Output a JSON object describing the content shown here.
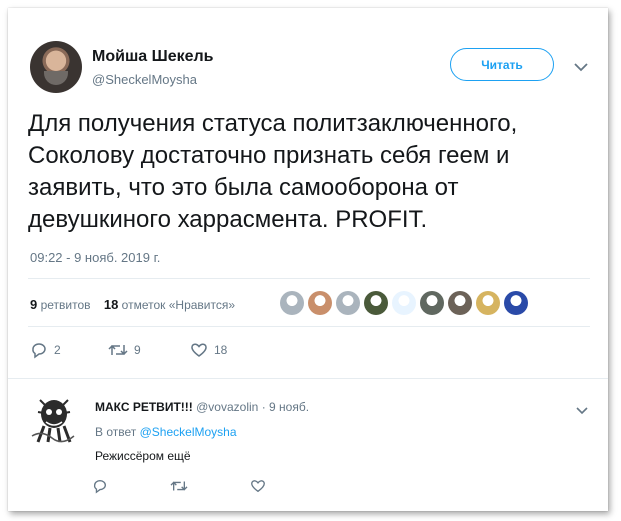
{
  "tweet": {
    "author_name": "Мойша Шекель",
    "author_handle": "@SheckelMoysha",
    "follow_label": "Читать",
    "text": "Для получения статуса политзаключенного,\nСоколову достаточно признать себя геем и\nзаявить, что это была самооборона от\nдевушкиного харрасмента. PROFIT.",
    "timestamp": "09:22 - 9 нояб. 2019 г.",
    "retweets_count": "9",
    "retweets_label": "ретвитов",
    "likes_count": "18",
    "likes_label": "отметок «Нравится»",
    "actions": {
      "reply_count": "2",
      "retweet_count": "9",
      "like_count": "18"
    },
    "liker_avatar_colors": [
      "#aab4bd",
      "#c98f6b",
      "#aab4bd",
      "#4a5a3a",
      "#e8f4ff",
      "#606860",
      "#6c6258",
      "#d6b460",
      "#2a4aa8"
    ]
  },
  "reply": {
    "author_name": "МАКС РЕТВИТ!!!",
    "author_handle": "@vovazolin",
    "time": "· 9 нояб.",
    "reply_to_prefix": "В ответ",
    "reply_to_handle": "@SheckelMoysha",
    "text": "Режиссёром ещё"
  },
  "colors": {
    "accent": "#1da1f2",
    "muted": "#657786",
    "text": "#14171a",
    "divider": "#e6ecf0"
  },
  "icons": [
    "caret-down-icon",
    "reply-icon",
    "retweet-icon",
    "heart-icon"
  ]
}
